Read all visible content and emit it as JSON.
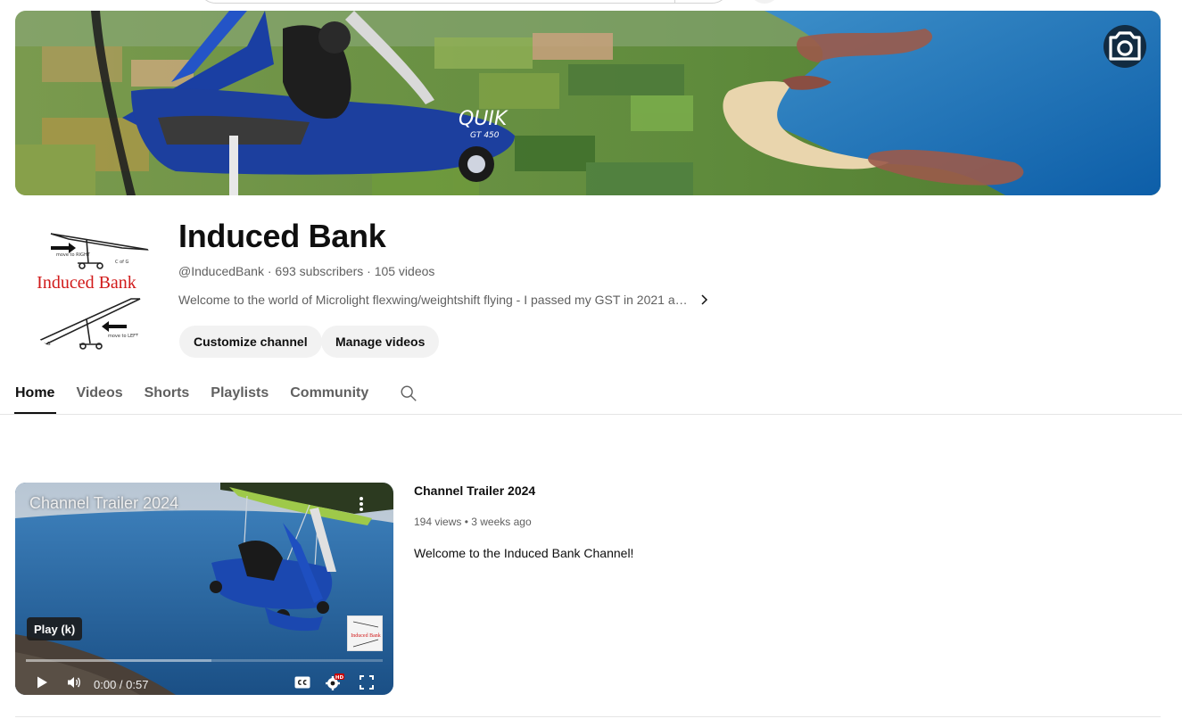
{
  "channel": {
    "name": "Induced Bank",
    "handle": "@InducedBank",
    "subscribers": "693 subscribers",
    "videos": "105 videos",
    "meta_separator": " · ",
    "description": "Welcome to the world of Microlight flexwing/weightshift flying - I passed my GST in 2021 a…",
    "avatar_text": "Induced Bank",
    "avatar_labels": [
      "move to RIGHT",
      "C of G",
      "move to LEFT",
      "< G"
    ]
  },
  "banner": {
    "aircraft_label": "QUIK",
    "aircraft_model": "GT 450",
    "camera_icon": "camera-icon"
  },
  "buttons": {
    "customize": "Customize channel",
    "manage": "Manage videos"
  },
  "tabs": [
    "Home",
    "Videos",
    "Shorts",
    "Playlists",
    "Community"
  ],
  "active_tab": "Home",
  "featured_video": {
    "overlay_title": "Channel Trailer 2024",
    "title": "Channel Trailer 2024",
    "views": "194 views",
    "age": "3 weeks ago",
    "meta_separator": " • ",
    "description": "Welcome to the Induced Bank Channel!",
    "tooltip": "Play (k)",
    "time_current": "0:00",
    "time_total": "0:57",
    "time_separator": " / ",
    "hd_badge": "HD",
    "progress": 0,
    "watermark_text": "Induced Bank"
  },
  "colors": {
    "text_primary": "#0f0f0f",
    "text_secondary": "#606060",
    "button_bg": "#f2f2f2",
    "progress_red": "#ff0000",
    "hd_badge": "#cc0000",
    "logo_red": "#d11a1a"
  }
}
